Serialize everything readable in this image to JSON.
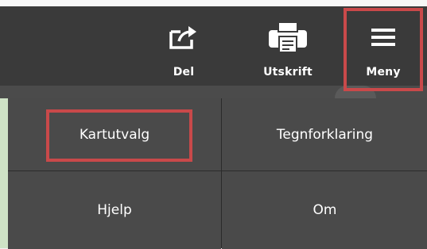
{
  "toolbar": {
    "share": {
      "label": "Del",
      "icon": "share-icon"
    },
    "print": {
      "label": "Utskrift",
      "icon": "printer-icon"
    },
    "menu": {
      "label": "Meny",
      "icon": "hamburger-icon"
    }
  },
  "menu": {
    "items": [
      {
        "label": "Kartutvalg"
      },
      {
        "label": "Tegnforklaring"
      },
      {
        "label": "Hjelp"
      },
      {
        "label": "Om"
      }
    ]
  },
  "colors": {
    "toolbar_bg": "#3a3a3a",
    "menu_cell_bg": "#4a4a4a",
    "highlight": "#c9494a",
    "text": "#ffffff"
  }
}
